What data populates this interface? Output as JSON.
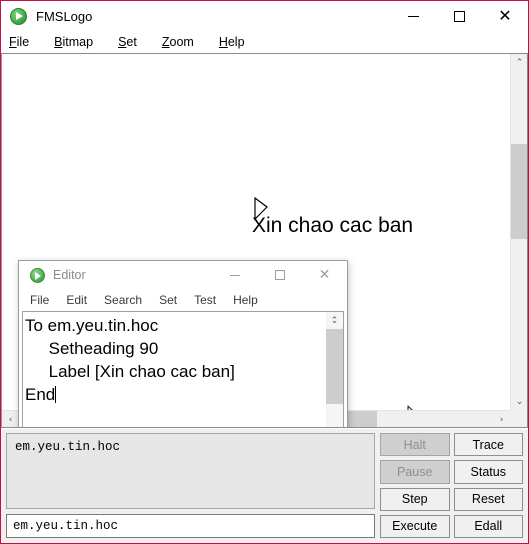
{
  "app": {
    "title": "FMSLogo",
    "logo_icon": "green-play-circle-icon",
    "window_controls": {
      "minimize": "minimize-icon",
      "maximize": "maximize-icon",
      "close": "close-icon"
    },
    "menu": [
      {
        "label": "File",
        "accel": "F",
        "rest": "ile"
      },
      {
        "label": "Bitmap",
        "accel": "B",
        "rest": "itmap"
      },
      {
        "label": "Set",
        "accel": "S",
        "rest": "et"
      },
      {
        "label": "Zoom",
        "accel": "Z",
        "rest": "oom"
      },
      {
        "label": "Help",
        "accel": "H",
        "rest": "elp"
      }
    ]
  },
  "canvas": {
    "label_text": "Xin chao cac ban",
    "turtle_cursor_icon": "turtle-arrow-icon",
    "mouse_cursor_icon": "mouse-pointer-icon",
    "scrollbar_vertical": {
      "up": "⌃",
      "down": "⌄"
    },
    "scrollbar_horizontal": {
      "left": "‹",
      "right": "›"
    }
  },
  "editor": {
    "title": "Editor",
    "logo_icon": "green-play-circle-icon",
    "window_controls": {
      "minimize": "minimize-icon",
      "maximize": "maximize-icon",
      "close": "close-icon"
    },
    "menu": [
      "File",
      "Edit",
      "Search",
      "Set",
      "Test",
      "Help"
    ],
    "code_lines": [
      "To em.yeu.tin.hoc",
      "     Setheading 90",
      "     Label [Xin chao cac ban]",
      "End"
    ],
    "code_text": "To em.yeu.tin.hoc\n     Setheading 90\n     Label [Xin chao cac ban]\nEnd",
    "scrollbar_vertical": {
      "up": "⌃",
      "down": "⌄"
    },
    "scrollbar_horizontal": {
      "left": "‹",
      "right": "›"
    },
    "resize_grip_icon": "resize-grip-icon"
  },
  "commander": {
    "history_text": "em.yeu.tin.hoc",
    "input_value": "em.yeu.tin.hoc",
    "buttons": [
      {
        "label": "Halt",
        "enabled": false
      },
      {
        "label": "Trace",
        "enabled": true
      },
      {
        "label": "Pause",
        "enabled": false
      },
      {
        "label": "Status",
        "enabled": true
      },
      {
        "label": "Step",
        "enabled": true
      },
      {
        "label": "Reset",
        "enabled": true
      },
      {
        "label": "Execute",
        "enabled": true
      },
      {
        "label": "Edall",
        "enabled": true
      }
    ]
  },
  "colors": {
    "window_border": "#c3103c",
    "logo_green": "#46b04a",
    "panel_bg": "#f0f0f0",
    "history_bg": "#e6e6e6",
    "disabled_btn_bg": "#cfcfcf"
  }
}
